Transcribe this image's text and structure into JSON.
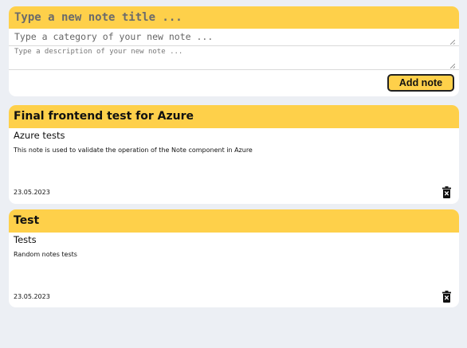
{
  "new_note": {
    "title_placeholder": "Type a new note title ...",
    "category_placeholder": "Type a category of your new note ...",
    "description_placeholder": "Type a description of your new note ...",
    "add_button_label": "Add note"
  },
  "notes": [
    {
      "title": "Final frontend test for Azure",
      "category": "Azure tests",
      "description": "This note is used to validate the operation of the Note component in Azure",
      "date": "23.05.2023",
      "delete_icon": "trash-icon"
    },
    {
      "title": "Test",
      "category": "Tests",
      "description": "Random notes tests",
      "date": "23.05.2023",
      "delete_icon": "trash-icon"
    }
  ],
  "colors": {
    "accent": "#fed04a",
    "background": "#eceff4",
    "card": "#ffffff"
  }
}
